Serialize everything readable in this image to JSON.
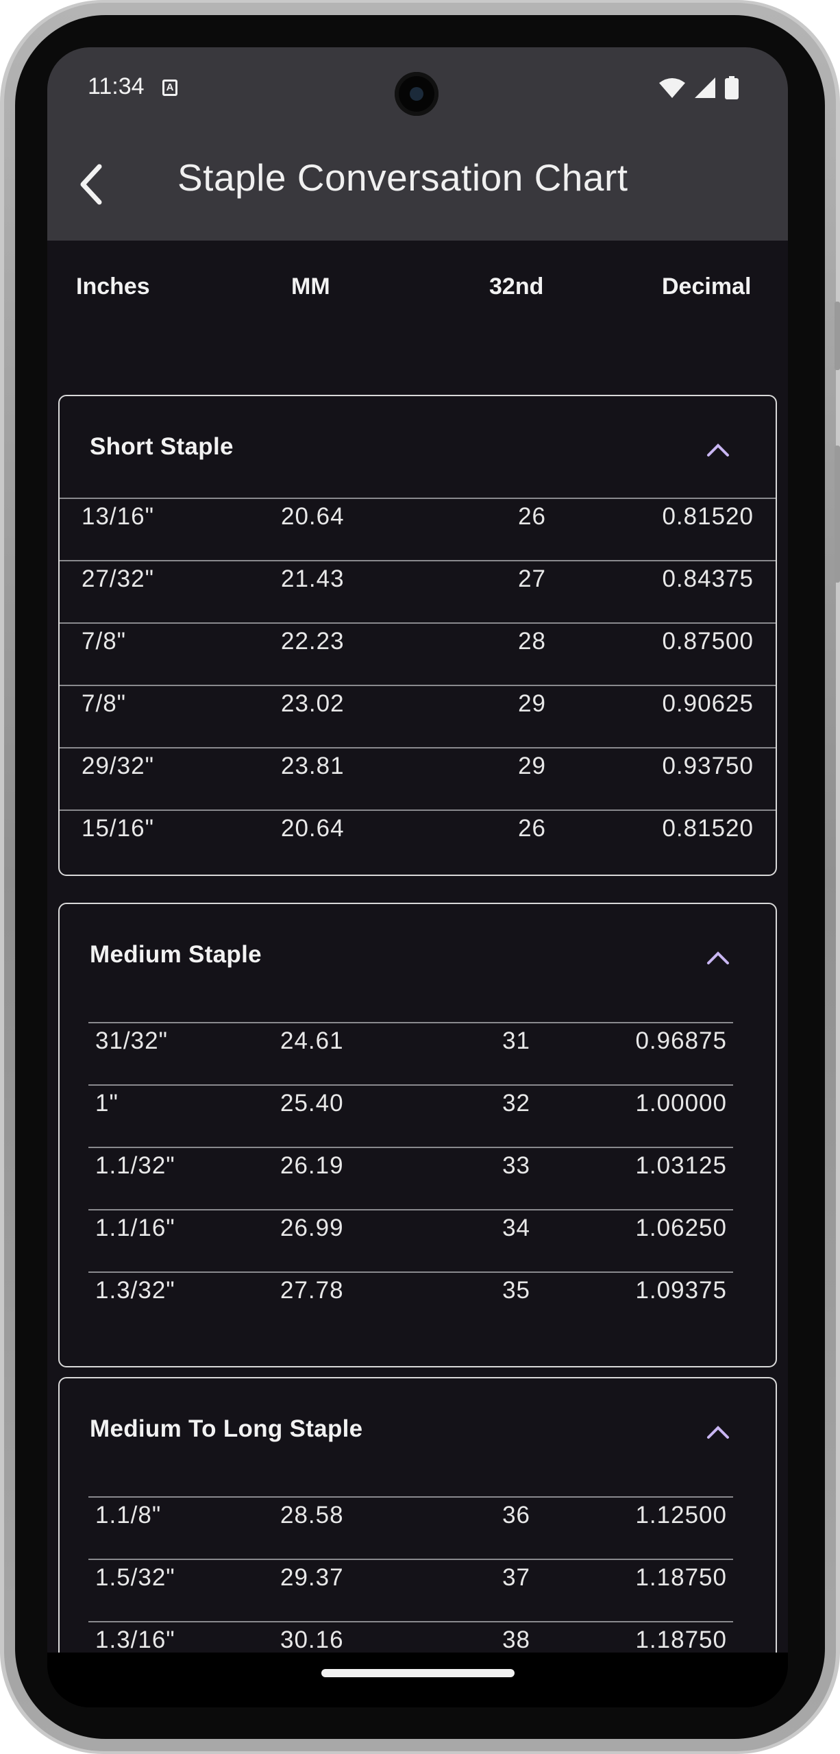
{
  "status_bar": {
    "time": "11:34",
    "a_badge": "A"
  },
  "app_bar": {
    "title": "Staple Conversation Chart"
  },
  "columns": {
    "inches": "Inches",
    "mm": "MM",
    "32nd": "32nd",
    "decimal": "Decimal"
  },
  "sections": [
    {
      "title": "Short Staple",
      "rows": [
        [
          "13/16\"",
          "20.64",
          "26",
          "0.81520"
        ],
        [
          "27/32\"",
          "21.43",
          "27",
          "0.84375"
        ],
        [
          "7/8\"",
          "22.23",
          "28",
          "0.87500"
        ],
        [
          "7/8\"",
          "23.02",
          "29",
          "0.90625"
        ],
        [
          "29/32\"",
          "23.81",
          "29",
          "0.93750"
        ],
        [
          "15/16\"",
          "20.64",
          "26",
          "0.81520"
        ]
      ]
    },
    {
      "title": "Medium Staple",
      "rows": [
        [
          "31/32\"",
          "24.61",
          "31",
          "0.96875"
        ],
        [
          "1\"",
          "25.40",
          "32",
          "1.00000"
        ],
        [
          "1.1/32\"",
          "26.19",
          "33",
          "1.03125"
        ],
        [
          "1.1/16\"",
          "26.99",
          "34",
          "1.06250"
        ],
        [
          "1.3/32\"",
          "27.78",
          "35",
          "1.09375"
        ]
      ]
    },
    {
      "title": "Medium To Long Staple",
      "rows": [
        [
          "1.1/8\"",
          "28.58",
          "36",
          "1.12500"
        ],
        [
          "1.5/32\"",
          "29.37",
          "37",
          "1.18750"
        ],
        [
          "1.3/16\"",
          "30.16",
          "38",
          "1.18750"
        ]
      ]
    }
  ],
  "colors": {
    "accent": "#c9b6f2",
    "surface": "#141218",
    "app_bar": "#39383d"
  }
}
